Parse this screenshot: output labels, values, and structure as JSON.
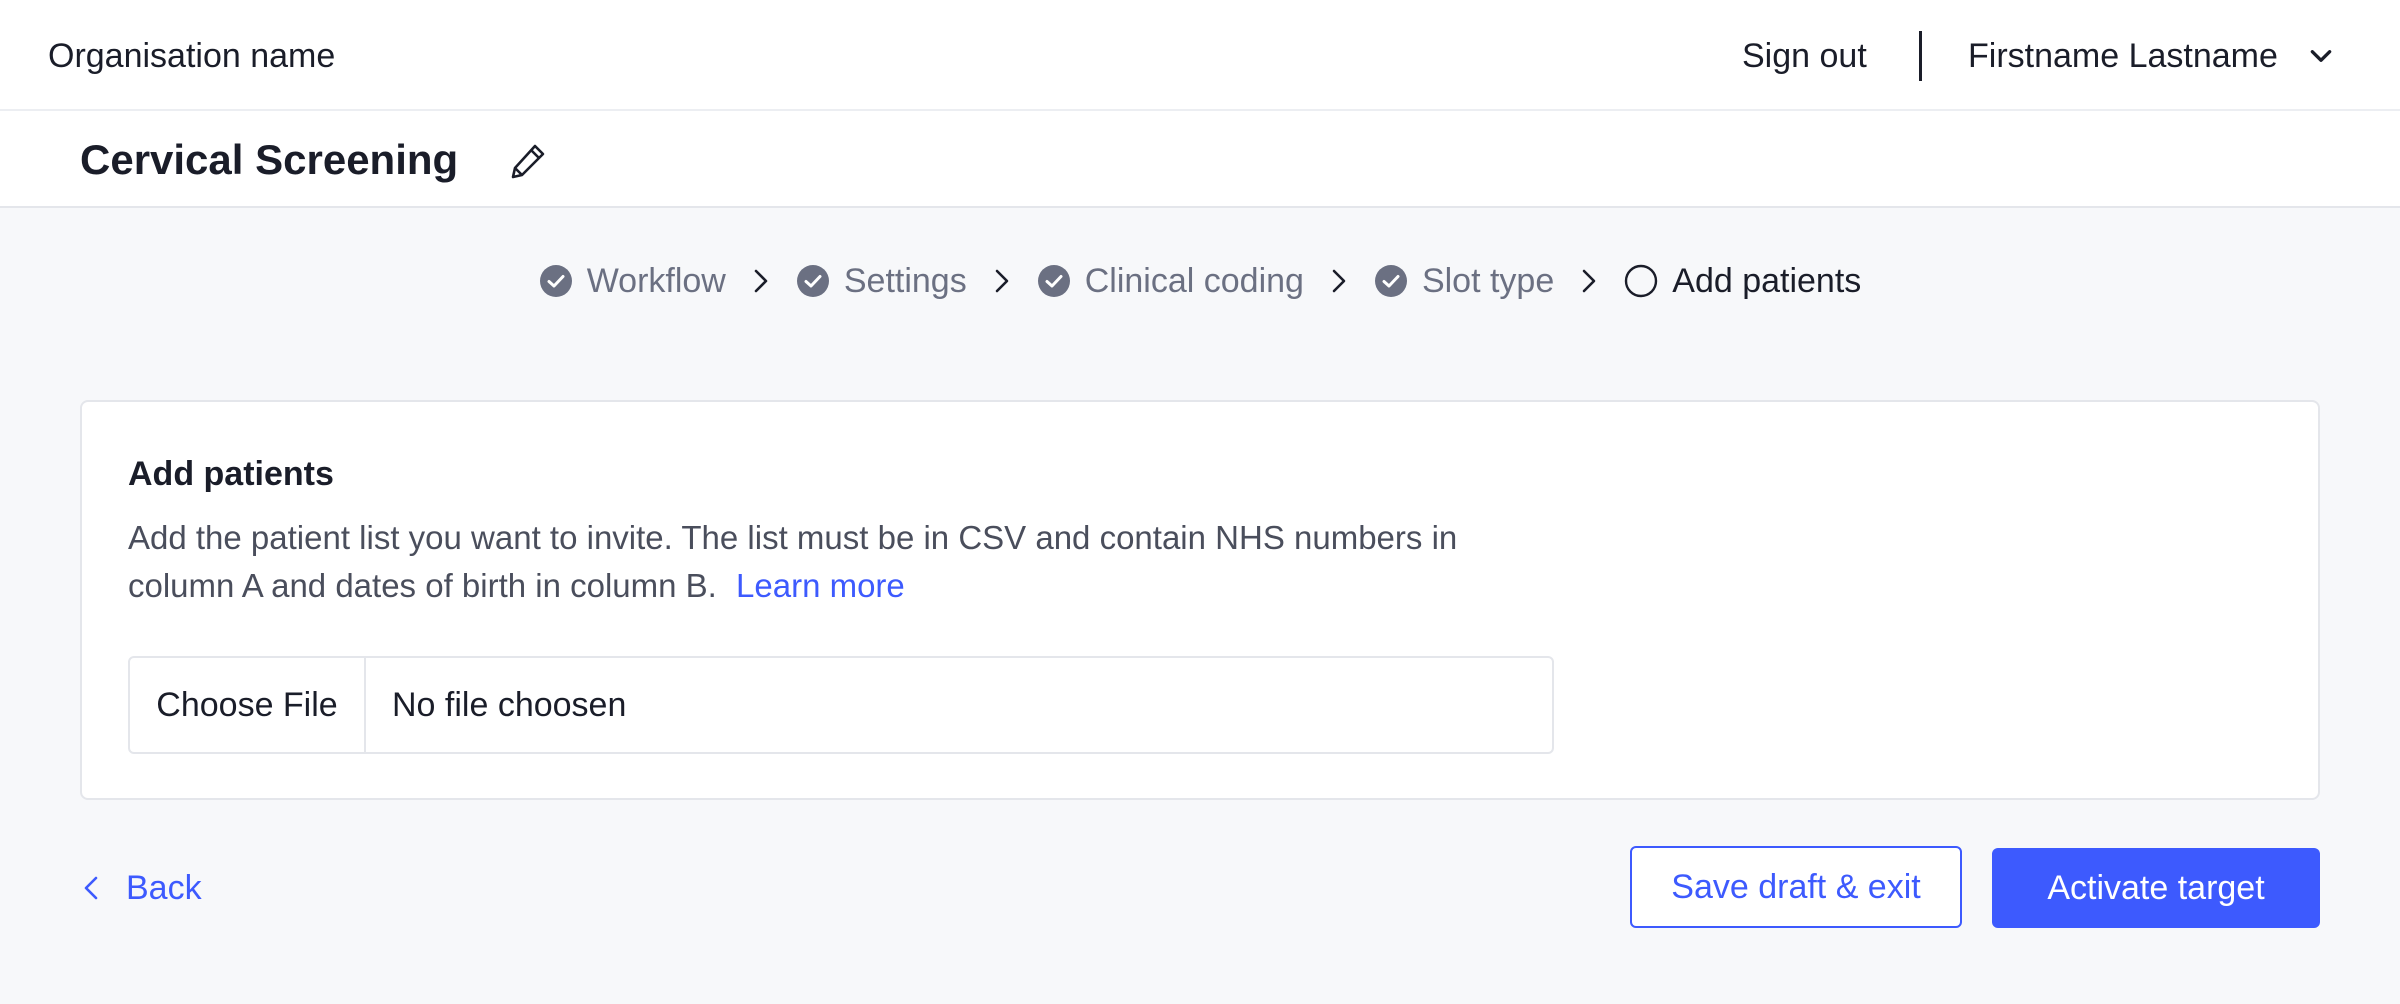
{
  "header": {
    "org_name": "Organisation name",
    "sign_out": "Sign out",
    "user_name": "Firstname Lastname"
  },
  "title_bar": {
    "title": "Cervical Screening"
  },
  "stepper": {
    "steps": [
      {
        "label": "Workflow",
        "state": "complete"
      },
      {
        "label": "Settings",
        "state": "complete"
      },
      {
        "label": "Clinical coding",
        "state": "complete"
      },
      {
        "label": "Slot type",
        "state": "complete"
      },
      {
        "label": "Add patients",
        "state": "current"
      }
    ]
  },
  "card": {
    "title": "Add patients",
    "description": "Add the patient list you want to invite. The list must be in CSV and contain NHS numbers in column A and dates of birth in column B.",
    "learn_more": "Learn more",
    "choose_file": "Choose File",
    "file_status": "No file choosen"
  },
  "footer": {
    "back": "Back",
    "save_draft": "Save draft & exit",
    "activate": "Activate target"
  },
  "colors": {
    "accent": "#3d5afe",
    "complete_step": "#6b7082",
    "text": "#1a1d29"
  },
  "icons": {
    "edit": "pencil-icon",
    "step_complete": "check-circle-icon",
    "step_current": "empty-circle-icon",
    "separator": "chevron-right-icon",
    "back": "chevron-left-icon",
    "user_menu": "chevron-down-icon"
  }
}
